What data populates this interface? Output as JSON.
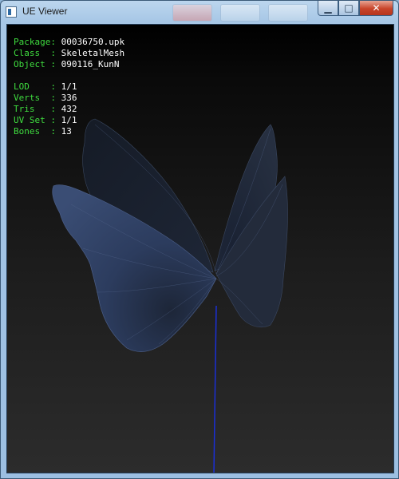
{
  "window": {
    "title": "UE Viewer",
    "icon": "app-window-icon",
    "controls": {
      "minimize_icon": "minimize-icon",
      "maximize_icon": "maximize-icon",
      "close_icon": "close-icon"
    }
  },
  "info": {
    "package": {
      "label": "Package: ",
      "value": "00036750.upk"
    },
    "class": {
      "label": "Class  : ",
      "value": "SkeletalMesh"
    },
    "object": {
      "label": "Object : ",
      "value": "090116_KunN"
    },
    "lod": {
      "label": "LOD    : ",
      "value": "1/1"
    },
    "verts": {
      "label": "Verts  : ",
      "value": "336"
    },
    "tris": {
      "label": "Tris   : ",
      "value": "432"
    },
    "uvset": {
      "label": "UV Set : ",
      "value": "1/1"
    },
    "bones": {
      "label": "Bones  : ",
      "value": "13"
    }
  },
  "colors": {
    "label": "#3fdc3f",
    "value": "#ffffff",
    "bone": "#1a2fd6",
    "wing": "#2b3a58"
  }
}
